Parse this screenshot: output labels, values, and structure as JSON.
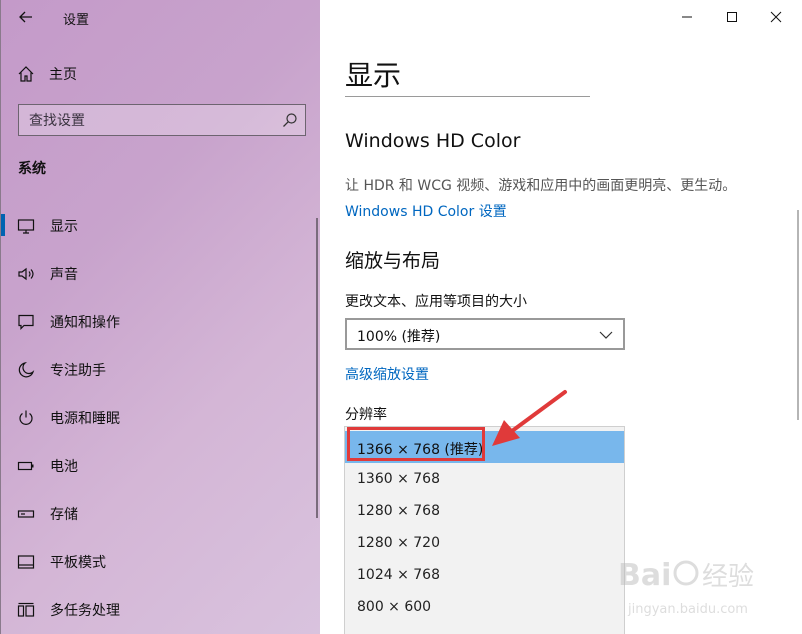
{
  "window": {
    "title": "设置",
    "controls": {
      "minimize": "minimize",
      "maximize": "maximize",
      "close": "close"
    }
  },
  "sidebar": {
    "home_label": "主页",
    "search_placeholder": "查找设置",
    "section_title": "系统",
    "items": [
      {
        "label": "显示",
        "icon": "monitor-icon",
        "active": true
      },
      {
        "label": "声音",
        "icon": "speaker-icon",
        "active": false
      },
      {
        "label": "通知和操作",
        "icon": "notification-icon",
        "active": false
      },
      {
        "label": "专注助手",
        "icon": "moon-icon",
        "active": false
      },
      {
        "label": "电源和睡眠",
        "icon": "power-icon",
        "active": false
      },
      {
        "label": "电池",
        "icon": "battery-icon",
        "active": false
      },
      {
        "label": "存储",
        "icon": "storage-icon",
        "active": false
      },
      {
        "label": "平板模式",
        "icon": "tablet-icon",
        "active": false
      },
      {
        "label": "多任务处理",
        "icon": "multitask-icon",
        "active": false
      }
    ]
  },
  "main": {
    "page_title": "显示",
    "hd_color": {
      "heading": "Windows HD Color",
      "description": "让 HDR 和 WCG 视频、游戏和应用中的画面更明亮、更生动。",
      "link": "Windows HD Color 设置"
    },
    "scale": {
      "heading": "缩放与布局",
      "label": "更改文本、应用等项目的大小",
      "selected": "100% (推荐)",
      "advanced_link": "高级缩放设置"
    },
    "resolution": {
      "label": "分辨率",
      "options": [
        "1366 × 768 (推荐)",
        "1360 × 768",
        "1280 × 768",
        "1280 × 720",
        "1024 × 768",
        "800 × 600"
      ],
      "selected_index": 0
    }
  },
  "watermark": {
    "text": "Bai 经验",
    "url": "jingyan.baidu.com"
  },
  "colors": {
    "accent": "#0063b1",
    "link": "#0067c0",
    "selection": "#78b7ec",
    "annotation": "#e03a3a"
  }
}
